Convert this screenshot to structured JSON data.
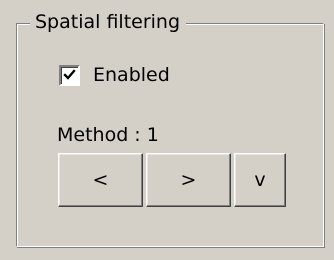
{
  "group": {
    "title": "Spatial filtering"
  },
  "enabled_checkbox": {
    "label": "Enabled",
    "checked": true
  },
  "method": {
    "label": "Method : 1"
  },
  "buttons": {
    "prev": "<",
    "next": ">",
    "down": "v"
  },
  "colors": {
    "face": "#d4d0c8",
    "shadow": "#808080",
    "dark_shadow": "#404040",
    "highlight": "#ffffff"
  },
  "icons": {
    "checkmark": "checkmark-icon"
  }
}
